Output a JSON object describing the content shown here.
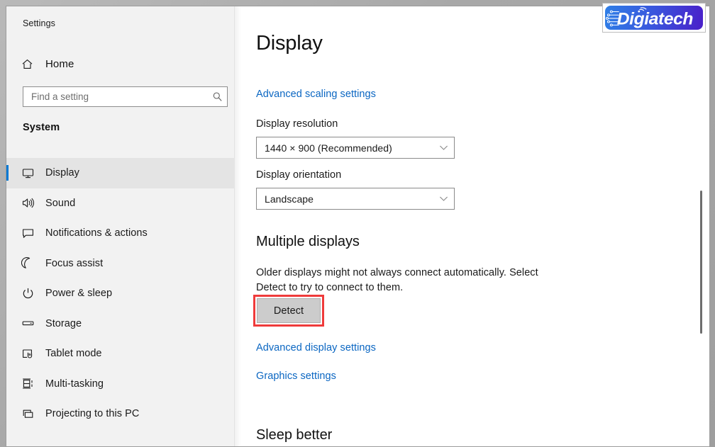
{
  "window": {
    "app_title": "Settings"
  },
  "sidebar": {
    "home": {
      "label": "Home",
      "icon": "home-icon"
    },
    "search": {
      "placeholder": "Find a setting",
      "value": "",
      "icon": "search-icon"
    },
    "group_header": "System",
    "items": [
      {
        "label": "Display",
        "icon": "monitor-icon",
        "selected": true
      },
      {
        "label": "Sound",
        "icon": "speaker-icon",
        "selected": false
      },
      {
        "label": "Notifications & actions",
        "icon": "notification-icon",
        "selected": false
      },
      {
        "label": "Focus assist",
        "icon": "moon-icon",
        "selected": false
      },
      {
        "label": "Power & sleep",
        "icon": "power-icon",
        "selected": false
      },
      {
        "label": "Storage",
        "icon": "drive-icon",
        "selected": false
      },
      {
        "label": "Tablet mode",
        "icon": "tablet-hand-icon",
        "selected": false
      },
      {
        "label": "Multi-tasking",
        "icon": "multitask-icon",
        "selected": false
      },
      {
        "label": "Projecting to this PC",
        "icon": "projecting-icon",
        "selected": false
      }
    ]
  },
  "main": {
    "page_title": "Display",
    "advanced_scaling_link": "Advanced scaling settings",
    "resolution_label": "Display resolution",
    "resolution_value": "1440 × 900 (Recommended)",
    "orientation_label": "Display orientation",
    "orientation_value": "Landscape",
    "multiple_displays_heading": "Multiple displays",
    "multiple_displays_text": "Older displays might not always connect automatically. Select Detect to try to connect to them.",
    "detect_button": "Detect",
    "advanced_display_link": "Advanced display settings",
    "graphics_settings_link": "Graphics settings",
    "sleep_better_heading": "Sleep better"
  },
  "logo": {
    "text": "Digiatech",
    "gradient_start": "#2f7fe6",
    "gradient_end": "#4a1fc9"
  },
  "colors": {
    "accent": "#0078d4",
    "link": "#0a66c2",
    "highlight": "#ef3b3b",
    "sidebar_bg": "#f2f2f2",
    "button_bg": "#cccccc"
  },
  "scrollbar": {
    "orientation": "vertical"
  }
}
